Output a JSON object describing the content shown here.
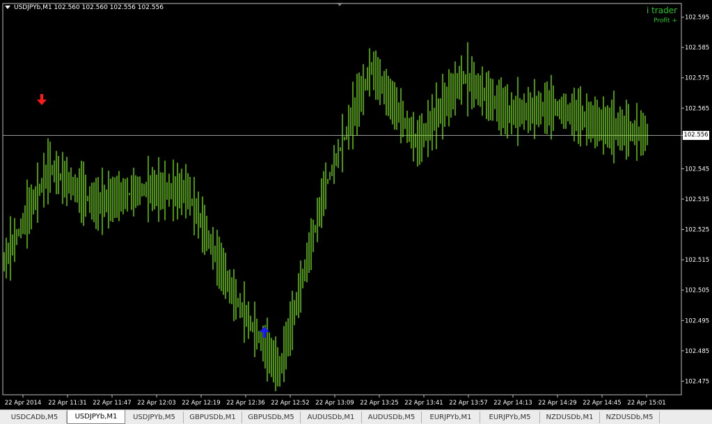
{
  "header": {
    "title": "USDJPYb,M1  102.560 102.560 102.556 102.556"
  },
  "brand": {
    "name": "i trader",
    "tagline": "Profit +"
  },
  "current_price": "102.556",
  "colors": {
    "background": "#000000",
    "candle": "#7CFC00",
    "axis": "#c0c0c0",
    "down_arrow": "#ff1a1a",
    "up_arrow": "#1a1aff",
    "price_line": "#9a9a9a"
  },
  "tabs": [
    {
      "label": "USDCADb,M5",
      "active": false
    },
    {
      "label": "USDJPYb,M1",
      "active": true
    },
    {
      "label": "USDJPYb,M5",
      "active": false
    },
    {
      "label": "GBPUSDb,M1",
      "active": false
    },
    {
      "label": "GBPUSDb,M5",
      "active": false
    },
    {
      "label": "AUDUSDb,M1",
      "active": false
    },
    {
      "label": "AUDUSDb,M5",
      "active": false
    },
    {
      "label": "EURJPYb,M1",
      "active": false
    },
    {
      "label": "EURJPYb,M5",
      "active": false
    },
    {
      "label": "NZDUSDb,M1",
      "active": false
    },
    {
      "label": "NZDUSDb,M5",
      "active": false
    }
  ],
  "chart_data": {
    "type": "line",
    "instrument": "USDJPYb",
    "timeframe": "M1",
    "x_ticks": [
      "22 Apr 2014",
      "22 Apr 11:31",
      "22 Apr 11:47",
      "22 Apr 12:03",
      "22 Apr 12:19",
      "22 Apr 12:36",
      "22 Apr 12:52",
      "22 Apr 13:09",
      "22 Apr 13:25",
      "22 Apr 13:41",
      "22 Apr 13:57",
      "22 Apr 14:13",
      "22 Apr 14:29",
      "22 Apr 14:45",
      "22 Apr 15:01"
    ],
    "y_ticks": [
      "102.595",
      "102.585",
      "102.575",
      "102.565",
      "102.556",
      "102.545",
      "102.535",
      "102.525",
      "102.515",
      "102.505",
      "102.495",
      "102.485",
      "102.475"
    ],
    "ylim": [
      102.4705,
      102.5995
    ],
    "current_price": 102.556,
    "series": [
      {
        "x": [
          "22 Apr 2014",
          "22 Apr 11:31",
          "22 Apr 11:47",
          "22 Apr 12:03",
          "22 Apr 12:19",
          "22 Apr 12:36",
          "22 Apr 12:52",
          "22 Apr 13:09",
          "22 Apr 13:25",
          "22 Apr 13:41",
          "22 Apr 13:57",
          "22 Apr 14:13",
          "22 Apr 14:29",
          "22 Apr 14:45",
          "22 Apr 15:01"
        ],
        "y": [
          102.514,
          102.545,
          102.533,
          102.538,
          102.537,
          102.503,
          102.478,
          102.539,
          102.578,
          102.553,
          102.575,
          102.563,
          102.565,
          102.559,
          102.556
        ]
      }
    ],
    "arrows": [
      {
        "direction": "down",
        "x": "22 Apr 2014",
        "y": 102.566
      },
      {
        "direction": "up",
        "x": "22 Apr 12:36",
        "y": 102.493
      }
    ]
  }
}
